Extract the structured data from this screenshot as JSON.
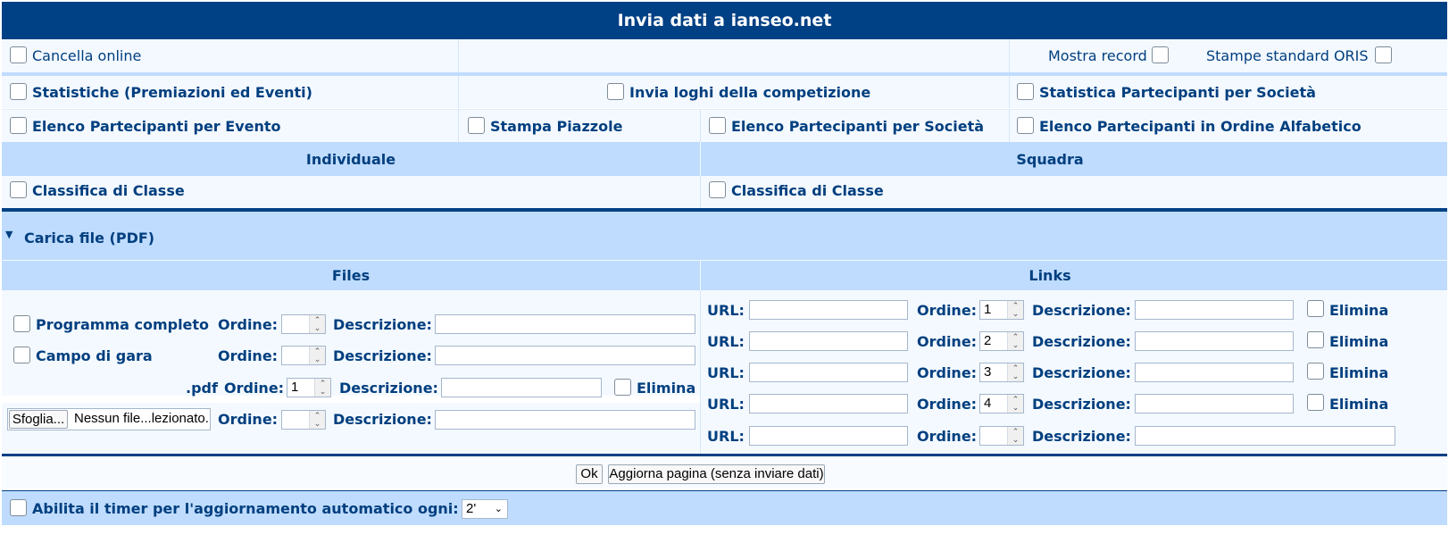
{
  "title": "Invia dati a ianseo.net",
  "top_options": {
    "cancella_online": "Cancella online",
    "mostra_record": "Mostra record",
    "stampe_oris": "Stampe standard ORIS"
  },
  "reports": {
    "statistiche": "Statistiche (Premiazioni ed Eventi)",
    "invia_loghi": "Invia loghi della competizione",
    "stat_partecipanti_societa": "Statistica Partecipanti per Società",
    "elenco_evento": "Elenco Partecipanti per Evento",
    "stampa_piazzole": "Stampa Piazzole",
    "elenco_societa": "Elenco Partecipanti per Società",
    "elenco_alfabetico": "Elenco Partecipanti in Ordine Alfabetico"
  },
  "sections": {
    "individuale": "Individuale",
    "squadra": "Squadra",
    "classifica_ind": "Classifica di Classe",
    "classifica_sq": "Classifica di Classe"
  },
  "upload": {
    "toggle_label": "Carica file (PDF)",
    "files_header": "Files",
    "links_header": "Links",
    "ordine_label": "Ordine:",
    "descrizione_label": "Descrizione:",
    "url_label": "URL:",
    "elimina_label": "Elimina",
    "files": [
      {
        "name": "Programma completo",
        "ordine": ""
      },
      {
        "name": "Campo di gara",
        "ordine": ""
      },
      {
        "name": ".pdf",
        "ordine": "1"
      },
      {
        "browse_label": "Sfoglia...",
        "no_file": "Nessun file...lezionato.",
        "ordine": ""
      }
    ],
    "links": [
      {
        "ordine": "1"
      },
      {
        "ordine": "2"
      },
      {
        "ordine": "3"
      },
      {
        "ordine": "4"
      },
      {
        "ordine": ""
      }
    ]
  },
  "actions": {
    "ok": "Ok",
    "refresh": "Aggiorna pagina (senza inviare dati)"
  },
  "timer": {
    "label": "Abilita il timer per l'aggiornamento automatico ogni:",
    "selected": "2'"
  }
}
